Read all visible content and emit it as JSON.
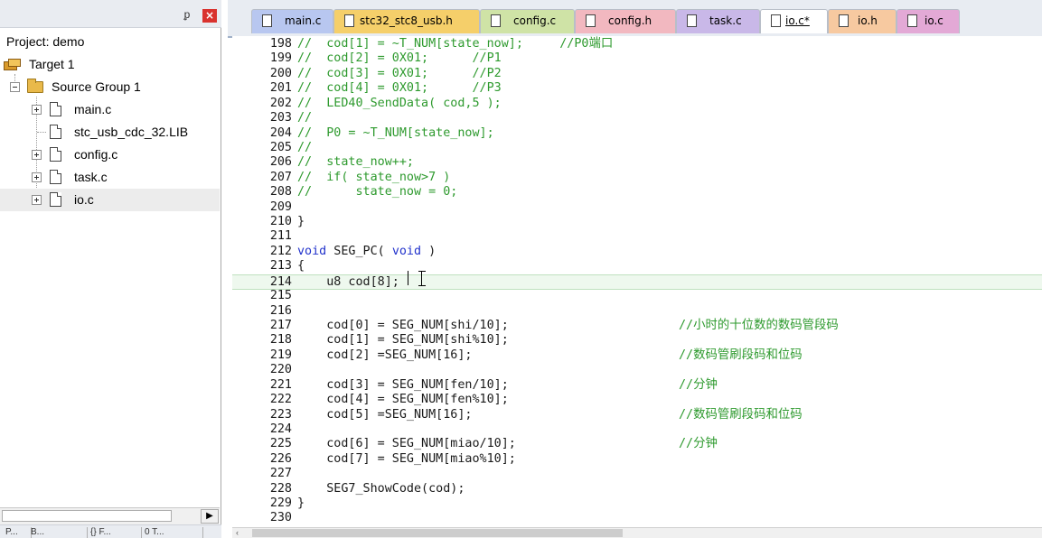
{
  "project_panel": {
    "title": "Project: demo",
    "target": "Target 1",
    "group": "Source Group 1",
    "files": [
      {
        "name": "main.c",
        "expandable": true
      },
      {
        "name": "stc_usb_cdc_32.LIB",
        "expandable": false
      },
      {
        "name": "config.c",
        "expandable": true
      },
      {
        "name": "task.c",
        "expandable": true
      },
      {
        "name": "io.c",
        "expandable": true
      }
    ],
    "selected_file": "io.c",
    "pin_glyph": "ᵱ",
    "close_glyph": "×",
    "bottom_tabs": [
      "P...",
      "B...",
      "{} F...",
      "0 T..."
    ]
  },
  "tabs": [
    {
      "label": "main.c",
      "color": "#b8c7f0"
    },
    {
      "label": "stc32_stc8_usb.h",
      "color": "#f5cf6a"
    },
    {
      "label": "config.c",
      "color": "#cfe3a6"
    },
    {
      "label": "config.h",
      "color": "#f2b8c0"
    },
    {
      "label": "task.c",
      "color": "#c9b8e8"
    },
    {
      "label": "io.c*",
      "color": "#a8d8cf"
    },
    {
      "label": "io.h",
      "color": "#f7c9a0"
    },
    {
      "label": "io.c",
      "color": "#e3a9d6"
    }
  ],
  "active_tab": "io.c*",
  "code_lines": [
    {
      "n": "198",
      "code": "//  cod[1] = ~T_NUM[state_now];     //P0端口"
    },
    {
      "n": "199",
      "code": "//  cod[2] = 0X01;      //P1"
    },
    {
      "n": "200",
      "code": "//  cod[3] = 0X01;      //P2"
    },
    {
      "n": "201",
      "code": "//  cod[4] = 0X01;      //P3"
    },
    {
      "n": "202",
      "code": "//  LED40_SendData( cod,5 );"
    },
    {
      "n": "203",
      "code": "//"
    },
    {
      "n": "204",
      "code": "//  P0 = ~T_NUM[state_now];"
    },
    {
      "n": "205",
      "code": "//"
    },
    {
      "n": "206",
      "code": "//  state_now++;"
    },
    {
      "n": "207",
      "code": "//  if( state_now>7 )"
    },
    {
      "n": "208",
      "code": "//      state_now = 0;"
    },
    {
      "n": "209",
      "code": ""
    },
    {
      "n": "210",
      "code": "}"
    },
    {
      "n": "211",
      "code": ""
    },
    {
      "n": "212",
      "code": "void SEG_PC( void )"
    },
    {
      "n": "213",
      "code": "{"
    },
    {
      "n": "214",
      "code": "    u8 cod[8];"
    },
    {
      "n": "215",
      "code": ""
    },
    {
      "n": "216",
      "code": ""
    },
    {
      "n": "217",
      "code": "    cod[0] = SEG_NUM[shi/10];",
      "comment": "//小时的十位数的数码管段码"
    },
    {
      "n": "218",
      "code": "    cod[1] = SEG_NUM[shi%10];"
    },
    {
      "n": "219",
      "code": "    cod[2] =SEG_NUM[16];",
      "comment": "//数码管刷段码和位码"
    },
    {
      "n": "220",
      "code": ""
    },
    {
      "n": "221",
      "code": "    cod[3] = SEG_NUM[fen/10];",
      "comment": "//分钟"
    },
    {
      "n": "222",
      "code": "    cod[4] = SEG_NUM[fen%10];"
    },
    {
      "n": "223",
      "code": "    cod[5] =SEG_NUM[16];",
      "comment": "//数码管刷段码和位码"
    },
    {
      "n": "224",
      "code": ""
    },
    {
      "n": "225",
      "code": "    cod[6] = SEG_NUM[miao/10];",
      "comment": "//分钟"
    },
    {
      "n": "226",
      "code": "    cod[7] = SEG_NUM[miao%10];"
    },
    {
      "n": "227",
      "code": ""
    },
    {
      "n": "228",
      "code": "    SEG7_ShowCode(cod);"
    },
    {
      "n": "229",
      "code": "}"
    },
    {
      "n": "230",
      "code": ""
    }
  ],
  "current_line": "214",
  "colors": {
    "comment": "#2e9a2e",
    "keyword": "#2233cc",
    "current_line_bg": "#eef8ee"
  }
}
